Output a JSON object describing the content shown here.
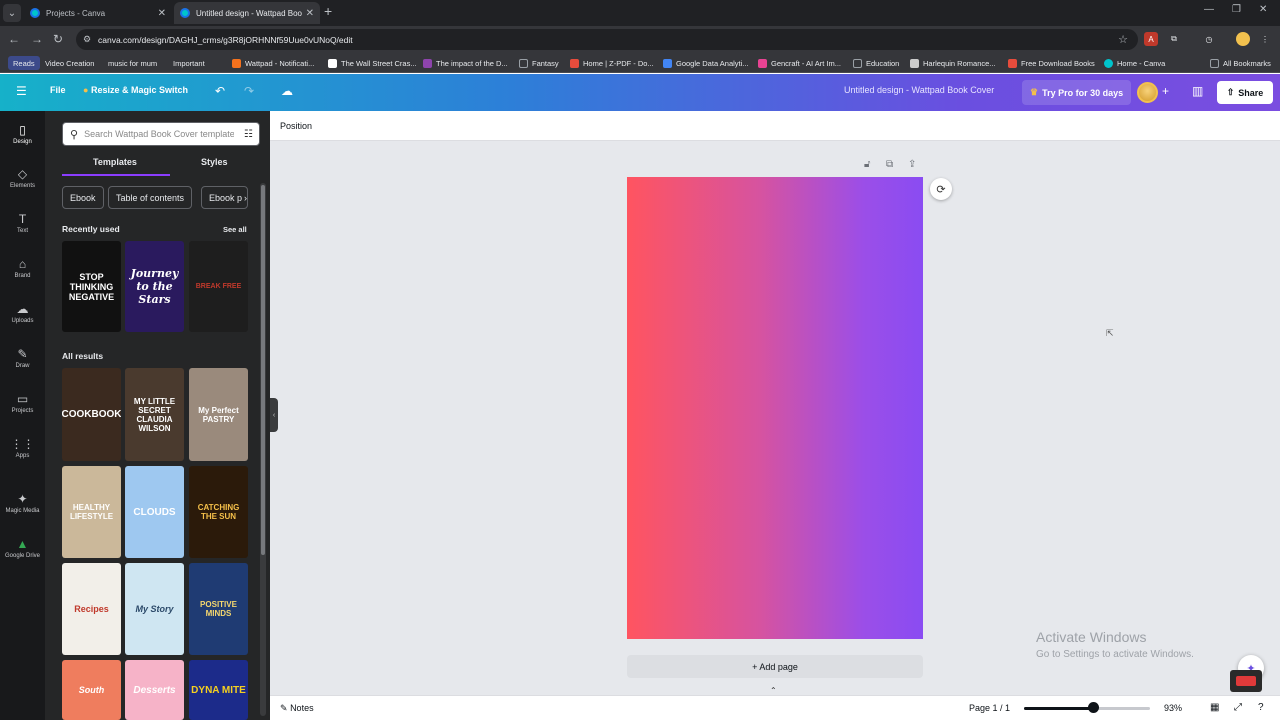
{
  "browser": {
    "tabs": [
      {
        "title": "Projects - Canva",
        "active": false
      },
      {
        "title": "Untitled design - Wattpad Book",
        "active": true
      }
    ],
    "url": "canva.com/design/DAGHJ_crms/g3R8jORHNNf59Uue0vUNoQ/edit",
    "bookmarks": [
      {
        "label": "Reads",
        "color": "#3c4a8a"
      },
      {
        "label": "Video Creation",
        "color": "#9aa0a6"
      },
      {
        "label": "music for mum",
        "color": "#9aa0a6"
      },
      {
        "label": "Important",
        "color": "#e2a03f"
      },
      {
        "label": "Wattpad - Notificati...",
        "color": "#f5721d"
      },
      {
        "label": "The Wall Street Cras...",
        "color": "#ffffff"
      },
      {
        "label": "The impact of the D...",
        "color": "#8e44ad"
      },
      {
        "label": "Fantasy",
        "color": "#9aa0a6"
      },
      {
        "label": "Home | Z-PDF - Do...",
        "color": "#e74c3c"
      },
      {
        "label": "Google Data Analyti...",
        "color": "#4285f4"
      },
      {
        "label": "Gencraft - AI Art Im...",
        "color": "#e84393"
      },
      {
        "label": "Education",
        "color": "#9aa0a6"
      },
      {
        "label": "Harlequin Romance...",
        "color": "#cccccc"
      },
      {
        "label": "Free Download Books",
        "color": "#e74c3c"
      },
      {
        "label": "Home - Canva",
        "color": "#00c4cc"
      },
      {
        "label": "All Bookmarks",
        "color": "#9aa0a6"
      }
    ]
  },
  "header": {
    "file": "File",
    "resize": "Resize & Magic Switch",
    "design_title": "Untitled design - Wattpad Book Cover",
    "try_pro": "Try Pro for 30 days",
    "share": "Share"
  },
  "rail": [
    {
      "label": "Design",
      "icon": "▯"
    },
    {
      "label": "Elements",
      "icon": "◇"
    },
    {
      "label": "Text",
      "icon": "T"
    },
    {
      "label": "Brand",
      "icon": "⌂"
    },
    {
      "label": "Uploads",
      "icon": "☁"
    },
    {
      "label": "Draw",
      "icon": "✎"
    },
    {
      "label": "Projects",
      "icon": "▭"
    },
    {
      "label": "Apps",
      "icon": "⋮"
    },
    {
      "label": "Magic Media",
      "icon": "✦"
    },
    {
      "label": "Google Drive",
      "icon": "▲"
    }
  ],
  "panel": {
    "search_placeholder": "Search Wattpad Book Cover templates",
    "tabs": [
      "Templates",
      "Styles"
    ],
    "chips": [
      "Ebook",
      "Table of contents",
      "Ebook p"
    ],
    "recently_used": "Recently used",
    "see_all": "See all",
    "all_results": "All results",
    "recent_thumbs": [
      {
        "text": "STOP THINKING NEGATIVE",
        "bg": "#111111",
        "fg": "#ffffff"
      },
      {
        "text": "Journey to the Stars",
        "bg": "#2a1a5e",
        "fg": "#ffffff"
      },
      {
        "text": "BREAK FREE",
        "bg": "#1e1e1e",
        "fg": "#c0392b"
      }
    ],
    "result_thumbs": [
      {
        "text": "COOKBOOK",
        "bg": "#3b2a1f",
        "fg": "#ffffff"
      },
      {
        "text": "MY LITTLE SECRET CLAUDIA WILSON",
        "bg": "#4a3a2e",
        "fg": "#ffffff"
      },
      {
        "text": "My Perfect PASTRY",
        "bg": "#9a8a7c",
        "fg": "#ffffff"
      },
      {
        "text": "HEALTHY LIFESTYLE",
        "bg": "#cbb89a",
        "fg": "#ffffff"
      },
      {
        "text": "CLOUDS",
        "bg": "#9ec8f0",
        "fg": "#ffffff"
      },
      {
        "text": "CATCHING THE SUN",
        "bg": "#2b1a0a",
        "fg": "#f5c04a"
      },
      {
        "text": "Recipes",
        "bg": "#f2efe9",
        "fg": "#c0392b"
      },
      {
        "text": "My Story",
        "bg": "#cfe6f2",
        "fg": "#2c4a6a"
      },
      {
        "text": "POSITIVE MINDS",
        "bg": "#1f3b73",
        "fg": "#f5d76e"
      },
      {
        "text": "South",
        "bg": "#ef7d5e",
        "fg": "#ffffff"
      },
      {
        "text": "Desserts",
        "bg": "#f6b3c8",
        "fg": "#ffffff"
      },
      {
        "text": "DYNA MITE",
        "bg": "#1c2b8a",
        "fg": "#f5d020"
      }
    ]
  },
  "editor": {
    "context_label": "Position",
    "add_page": "+ Add page",
    "page_gradient": [
      "#ff5460",
      "#8a4cf2"
    ]
  },
  "watermark": {
    "line1": "Activate Windows",
    "line2": "Go to Settings to activate Windows."
  },
  "footer": {
    "notes": "Notes",
    "page": "Page 1 / 1",
    "zoom": "93%",
    "zoom_level": 0.93
  }
}
